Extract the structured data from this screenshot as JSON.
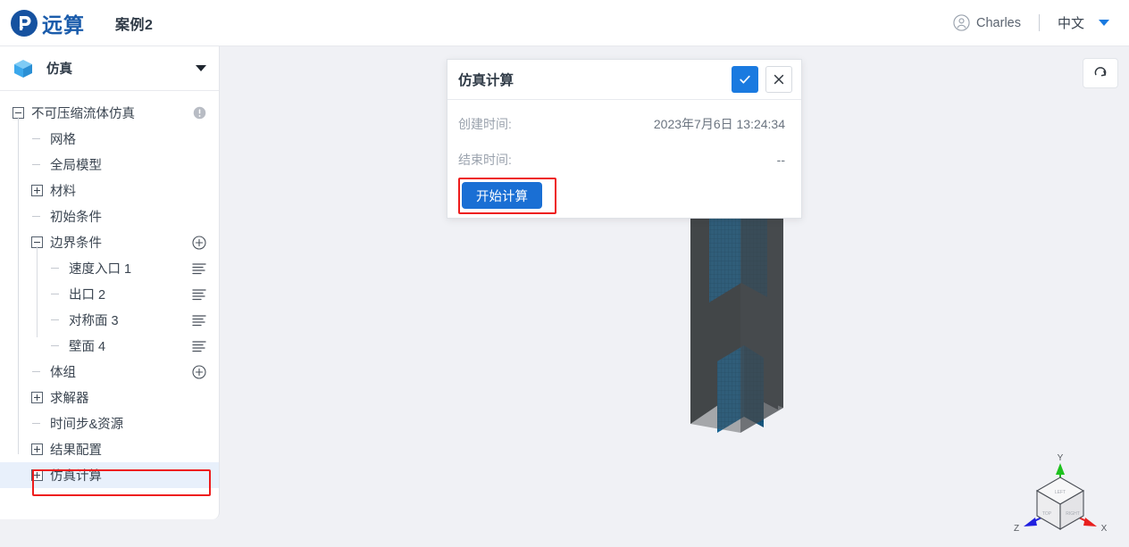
{
  "header": {
    "logo_text": "远算",
    "logo_icon": "yuansuan-logo-icon",
    "case_title": "案例2",
    "user_name": "Charles",
    "user_icon": "user-avatar-icon",
    "language": "中文",
    "caret_icon": "chevron-down-icon"
  },
  "sidebar": {
    "head": {
      "icon": "cube-icon",
      "label": "仿真",
      "caret": "chevron-down-icon"
    },
    "tree": [
      {
        "label": "不可压缩流体仿真",
        "toggle": "minus",
        "depth": 0,
        "action": "warning-icon"
      },
      {
        "label": "网格",
        "toggle": "stub",
        "depth": 1,
        "action": "none"
      },
      {
        "label": "全局模型",
        "toggle": "stub",
        "depth": 1,
        "action": "none"
      },
      {
        "label": "材料",
        "toggle": "plus",
        "depth": 1,
        "action": "none"
      },
      {
        "label": "初始条件",
        "toggle": "stub",
        "depth": 1,
        "action": "none"
      },
      {
        "label": "边界条件",
        "toggle": "minus",
        "depth": 1,
        "action": "plus-icon"
      },
      {
        "label": "速度入口 1",
        "toggle": "stub",
        "depth": 2,
        "action": "lines-icon"
      },
      {
        "label": "出口 2",
        "toggle": "stub",
        "depth": 2,
        "action": "lines-icon"
      },
      {
        "label": "对称面 3",
        "toggle": "stub",
        "depth": 2,
        "action": "lines-icon"
      },
      {
        "label": "壁面 4",
        "toggle": "stub",
        "depth": 2,
        "action": "lines-icon"
      },
      {
        "label": "体组",
        "toggle": "stub",
        "depth": 1,
        "action": "plus-icon"
      },
      {
        "label": "求解器",
        "toggle": "plus",
        "depth": 1,
        "action": "none"
      },
      {
        "label": "时间步&资源",
        "toggle": "stub",
        "depth": 1,
        "action": "none"
      },
      {
        "label": "结果配置",
        "toggle": "plus",
        "depth": 1,
        "action": "none"
      },
      {
        "label": "仿真计算",
        "toggle": "plus",
        "depth": 1,
        "action": "none",
        "selected": true,
        "highlighted": true
      }
    ]
  },
  "dialog": {
    "title": "仿真计算",
    "confirm_icon": "check-icon",
    "close_icon": "close-icon",
    "rows": [
      {
        "key": "创建时间:",
        "value": "2023年7月6日 13:24:34"
      },
      {
        "key": "结束时间:",
        "value": "--"
      }
    ],
    "start_button": "开始计算",
    "start_button_highlighted": true
  },
  "canvas": {
    "reset_icon": "reset-view-icon",
    "axis_cube": {
      "x_label": "X",
      "y_label": "Y",
      "z_label": "Z",
      "x_color": "#e8201e",
      "y_color": "#1ec11e",
      "z_color": "#2020e0",
      "faces": [
        "TOP",
        "LEFT",
        "RIGHT"
      ]
    },
    "model": {
      "body_color": "#46494c",
      "mesh_color": "#1d6b9c"
    }
  },
  "colors": {
    "accent_blue": "#1a7ae0",
    "brand_blue": "#1b5cab",
    "annotation_red": "#ee1c1c",
    "canvas_bg": "#f0f1f5",
    "selected_bg": "#e8f0fb"
  }
}
